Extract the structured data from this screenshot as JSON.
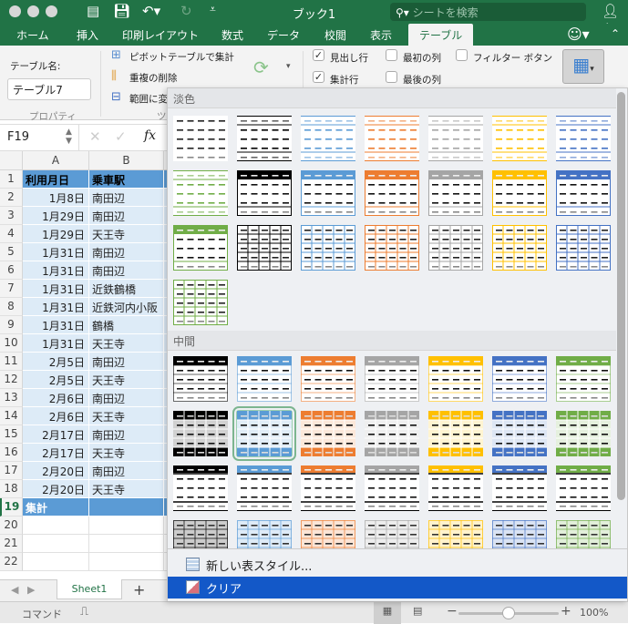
{
  "window": {
    "title": "ブック1",
    "search_placeholder": "シートを検索"
  },
  "tabs": [
    "ホーム",
    "挿入",
    "印刷レイアウト",
    "数式",
    "データ",
    "校閲",
    "表示",
    "テーブル"
  ],
  "ribbon": {
    "table_name_label": "テーブル名:",
    "table_name_value": "テーブル7",
    "properties_group": "プロパティ",
    "tools_group": "ツ",
    "pivot": "ピボットテーブルで集計",
    "remove_dup": "重複の削除",
    "convert_range": "範囲に変",
    "header_row": {
      "label": "見出し行",
      "checked": true
    },
    "total_row": {
      "label": "集計行",
      "checked": true
    },
    "first_col": {
      "label": "最初の列",
      "checked": false
    },
    "last_col": {
      "label": "最後の列",
      "checked": false
    },
    "filter_btn": {
      "label": "フィルター ボタン",
      "checked": false
    }
  },
  "formula": {
    "namebox": "F19",
    "fx": "fx"
  },
  "columns": [
    "A",
    "B"
  ],
  "rows": [
    {
      "n": "1",
      "a": "利用月日",
      "b": "乗車駅",
      "type": "hdr"
    },
    {
      "n": "2",
      "a": "1月8日",
      "b": "南田辺"
    },
    {
      "n": "3",
      "a": "1月29日",
      "b": "南田辺"
    },
    {
      "n": "4",
      "a": "1月29日",
      "b": "天王寺"
    },
    {
      "n": "5",
      "a": "1月31日",
      "b": "南田辺"
    },
    {
      "n": "6",
      "a": "1月31日",
      "b": "南田辺"
    },
    {
      "n": "7",
      "a": "1月31日",
      "b": "近鉄鶴橋"
    },
    {
      "n": "8",
      "a": "1月31日",
      "b": "近鉄河内小阪"
    },
    {
      "n": "9",
      "a": "1月31日",
      "b": "鶴橋"
    },
    {
      "n": "10",
      "a": "1月31日",
      "b": "天王寺"
    },
    {
      "n": "11",
      "a": "2月5日",
      "b": "南田辺"
    },
    {
      "n": "12",
      "a": "2月5日",
      "b": "天王寺"
    },
    {
      "n": "13",
      "a": "2月6日",
      "b": "南田辺"
    },
    {
      "n": "14",
      "a": "2月6日",
      "b": "天王寺"
    },
    {
      "n": "15",
      "a": "2月17日",
      "b": "南田辺"
    },
    {
      "n": "16",
      "a": "2月17日",
      "b": "天王寺"
    },
    {
      "n": "17",
      "a": "2月20日",
      "b": "南田辺"
    },
    {
      "n": "18",
      "a": "2月20日",
      "b": "天王寺"
    },
    {
      "n": "19",
      "a": "集計",
      "b": "",
      "type": "tot"
    },
    {
      "n": "20",
      "a": "",
      "b": "",
      "type": "empty"
    },
    {
      "n": "21",
      "a": "",
      "b": "",
      "type": "empty"
    },
    {
      "n": "22",
      "a": "",
      "b": "",
      "type": "empty"
    }
  ],
  "gallery": {
    "light_label": "淡色",
    "medium_label": "中間",
    "colors": [
      "#000000",
      "#5b9bd5",
      "#ed7d31",
      "#a5a5a5",
      "#ffc000",
      "#4472c4",
      "#70ad47"
    ],
    "selected": {
      "section": "medium",
      "index": 8
    },
    "new_style": "新しい表スタイル...",
    "clear": "クリア"
  },
  "sheet": {
    "tab": "Sheet1",
    "add": "+"
  },
  "status": {
    "mode": "コマンド",
    "zoom": "100%",
    "zoom_level": 0.5
  }
}
